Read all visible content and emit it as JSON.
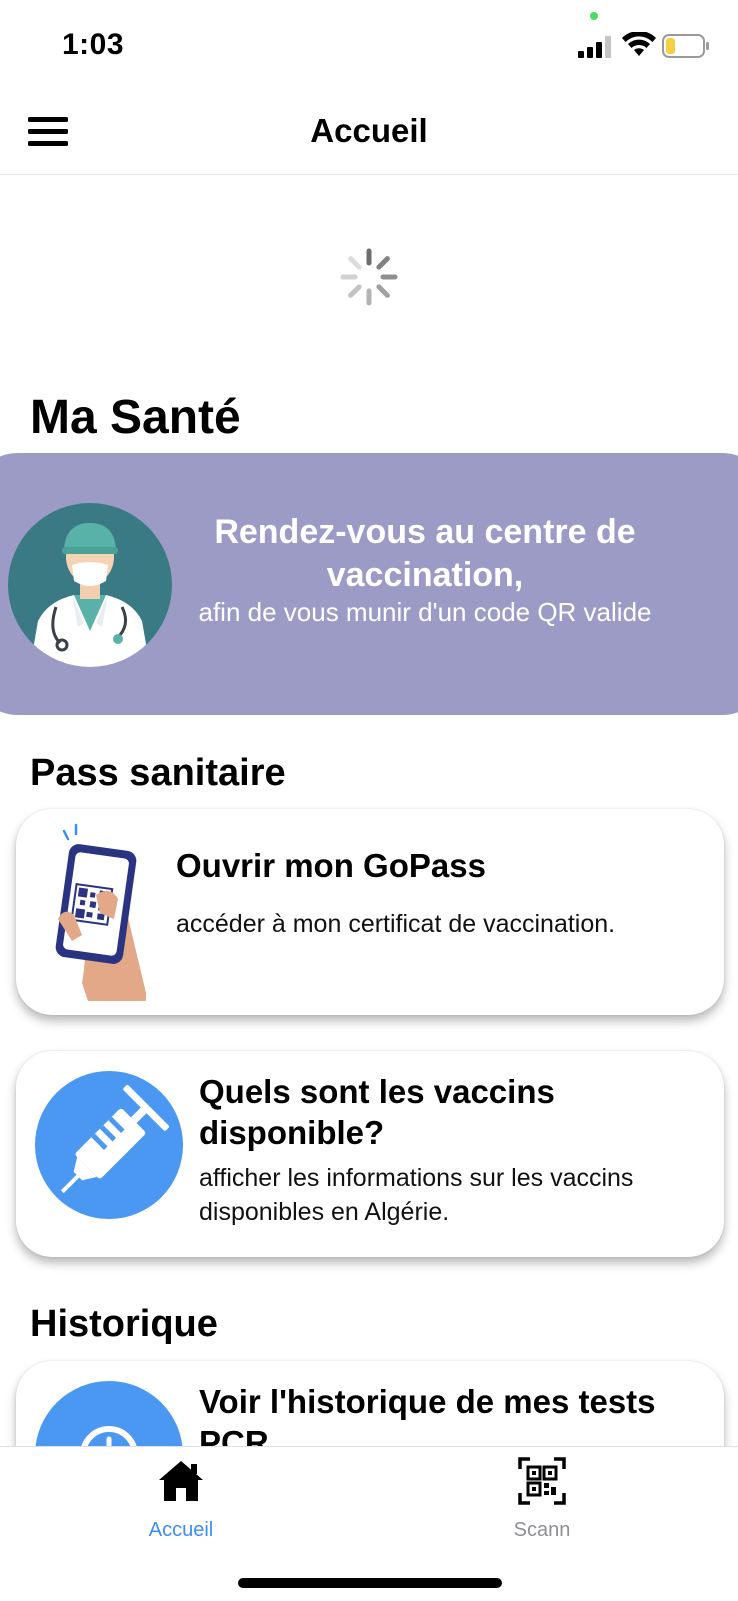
{
  "status_bar": {
    "time": "1:03"
  },
  "nav": {
    "title": "Accueil"
  },
  "sections": {
    "health": "Ma Santé",
    "pass": "Pass sanitaire",
    "history": "Historique"
  },
  "banner": {
    "title": "Rendez-vous au centre de vaccination,",
    "subtitle": "afin de vous munir d'un code QR valide"
  },
  "cards": {
    "gopass": {
      "title": "Ouvrir mon GoPass",
      "subtitle": "accéder à mon certificat de vaccination."
    },
    "vaccins": {
      "title": "Quels sont les vaccins disponible?",
      "subtitle": "afficher les informations sur les vaccins disponibles en Algérie."
    },
    "history": {
      "title": "Voir l'historique de mes tests PCR"
    }
  },
  "tabs": [
    {
      "label": "Accueil",
      "icon": "home-icon",
      "active": true
    },
    {
      "label": "Scann",
      "icon": "qr-scan-icon",
      "active": false
    }
  ],
  "colors": {
    "banner": "#9c9bc6",
    "accent_blue": "#4a98f1",
    "active_tab": "#3c8ef0",
    "inactive_tab": "#8e8e93"
  }
}
